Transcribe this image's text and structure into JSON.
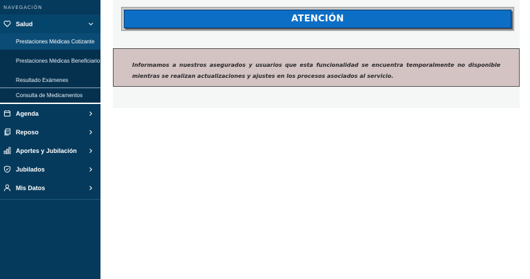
{
  "sidebar": {
    "heading": "NAVEGACIÓN",
    "items": [
      {
        "label": "Salud",
        "icon": "heart-icon",
        "expanded": true
      },
      {
        "label": "Agenda",
        "icon": "calendar-icon"
      },
      {
        "label": "Reposo",
        "icon": "documents-icon"
      },
      {
        "label": "Aportes y Jubilación",
        "icon": "bar-chart-icon"
      },
      {
        "label": "Jubilados",
        "icon": "shield-icon"
      },
      {
        "label": "Mis Datos",
        "icon": "user-icon"
      }
    ],
    "salud_submenu": [
      {
        "label": "Prestaciones Médicas Cotizante",
        "active": true
      },
      {
        "label": "Prestaciones Médicas Beneficiario"
      },
      {
        "label": "Resultado Exámenes"
      },
      {
        "label": "Consulta de Medicamentos"
      }
    ]
  },
  "main": {
    "banner_title": "ATENCIÓN",
    "notice": "Informamos a nuestros asegurados y usuarios que esta funcionalidad se encuentra temporalmente no disponible mientras se realizan actualizaciones y ajustes en los procesos asociados al servicio."
  },
  "colors": {
    "sidebar_bg": "#053a5c",
    "banner_blue": "#0d6ec6",
    "notice_bg": "#d3c3c3"
  }
}
